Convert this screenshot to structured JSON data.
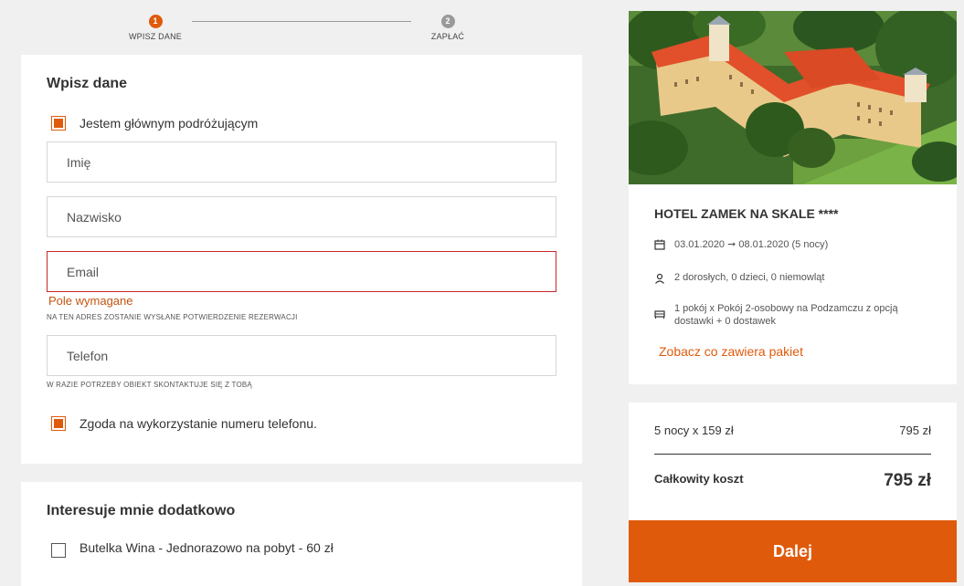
{
  "stepper": {
    "steps": [
      {
        "number": "1",
        "label": "WPISZ DANE"
      },
      {
        "number": "2",
        "label": "ZAPŁAĆ"
      }
    ]
  },
  "form": {
    "title": "Wpisz dane",
    "main_traveler_label": "Jestem głównym podróżującym",
    "main_traveler_checked": true,
    "first_name_placeholder": "Imię",
    "last_name_placeholder": "Nazwisko",
    "email_placeholder": "Email",
    "email_error": "Pole wymagane",
    "email_hint": "NA TEN ADRES ZOSTANIE WYSŁANE POTWIERDZENIE REZERWACJI",
    "phone_placeholder": "Telefon",
    "phone_hint": "W RAZIE POTRZEBY OBIEKT SKONTAKTUJE SIĘ Z TOBĄ",
    "phone_consent_label": "Zgoda na wykorzystanie numeru telefonu.",
    "phone_consent_checked": true
  },
  "extras": {
    "title": "Interesuje mnie dodatkowo",
    "items": [
      {
        "label": "Butelka Wina - Jednorazowo na pobyt - 60 zł",
        "checked": false
      }
    ]
  },
  "hotel": {
    "name": "HOTEL ZAMEK NA SKALE ****",
    "dates": "03.01.2020 ➞ 08.01.2020 (5 nocy)",
    "guests": "2 dorosłych, 0 dzieci, 0 niemowląt",
    "room": "1 pokój x Pokój 2-osobowy na Podzamczu z opcją dostawki + 0 dostawek",
    "package_link": "Zobacz co zawiera pakiet"
  },
  "price": {
    "nights_label": "5 nocy x 159 zł",
    "nights_value": "795 zł",
    "total_label": "Całkowity koszt",
    "total_value": "795 zł"
  },
  "actions": {
    "next_label": "Dalej"
  },
  "colors": {
    "accent": "#e05a0c",
    "error": "#c62828",
    "background": "#f0f0f0"
  }
}
